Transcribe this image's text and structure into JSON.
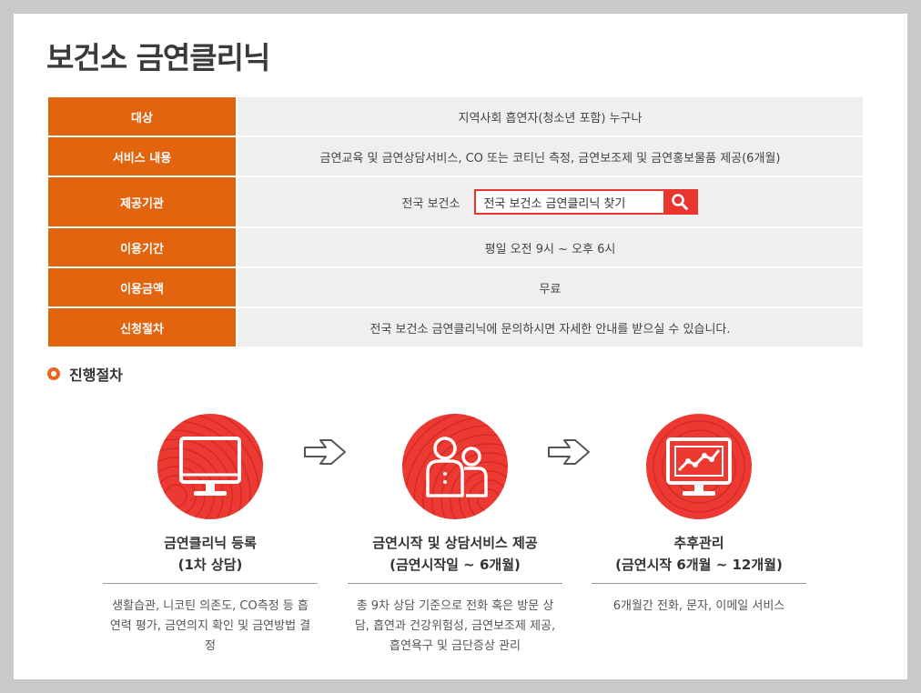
{
  "title": "보건소 금연클리닉",
  "info": {
    "target": {
      "label": "대상",
      "value": "지역사회 흡연자(청소년 포함) 누구나"
    },
    "service": {
      "label": "서비스 내용",
      "value": "금연교육 및 금연상담서비스, CO 또는 코티닌 측정, 금연보조제 및 금연홍보물품 제공(6개월)"
    },
    "provider": {
      "label": "제공기관",
      "value": "전국 보건소",
      "search_value": "전국 보건소 금연클리닉 찾기"
    },
    "period": {
      "label": "이용기간",
      "value": "평일 오전 9시 ~ 오후 6시"
    },
    "fee": {
      "label": "이용금액",
      "value": "무료"
    },
    "apply": {
      "label": "신청절차",
      "value": "전국 보건소 금연클리닉에 문의하시면 자세한 안내를 받으실 수 있습니다."
    }
  },
  "process": {
    "title": "진행절차",
    "steps": [
      {
        "title1": "금연클리닉 등록",
        "title2": "(1차 상담)",
        "desc": "생활습관, 니코틴 의존도, CO측정 등 흡연력 평가, 금연의지 확인 및 금연방법 결정",
        "icon": "monitor-icon"
      },
      {
        "title1": "금연시작 및 상담서비스 제공",
        "title2": "(금연시작일 ~ 6개월)",
        "desc": "총 9차 상담 기준으로 전화 혹은 방문 상담, 흡연과 건강위험성, 금연보조제 제공, 흡연욕구 및 금단증상 관리",
        "icon": "people-icon"
      },
      {
        "title1": "추후관리",
        "title2": "(금연시작 6개월 ~ 12개월)",
        "desc": "6개월간 전화, 문자, 이메일 서비스",
        "icon": "chart-monitor-icon"
      }
    ]
  },
  "colors": {
    "accent": "#e3640f",
    "circle": "#ec3a33",
    "row_bg": "#efefef"
  }
}
